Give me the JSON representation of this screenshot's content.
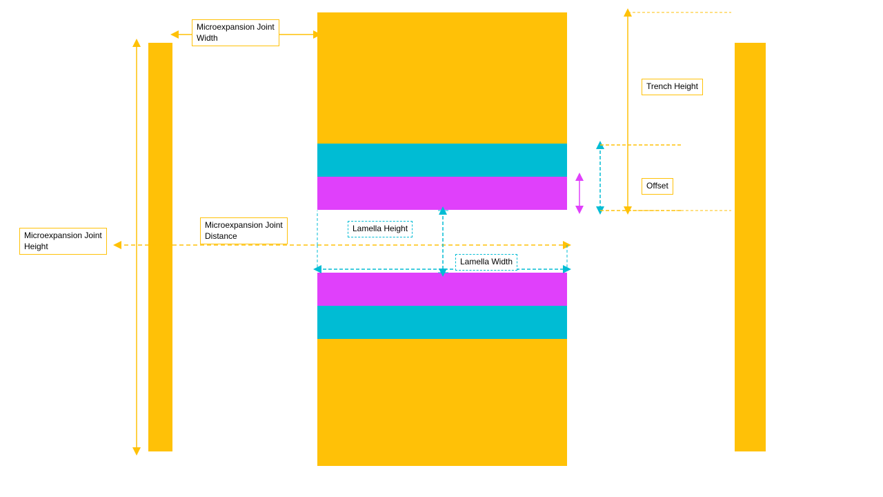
{
  "labels": {
    "microexpansion_joint_width": "Microexpansion Joint\nWidth",
    "microexpansion_joint_distance": "Microexpansion Joint\nDistance",
    "microexpansion_joint_height": "Microexpansion Joint\nHeight",
    "lamella_height": "Lamella Height",
    "lamella_width": "Lamella Width",
    "trench_height": "Trench Height",
    "offset": "Offset"
  },
  "colors": {
    "gold": "#ffc107",
    "cyan": "#00bcd4",
    "magenta": "#e040fb",
    "arrow_gold": "#ffc107",
    "arrow_cyan": "#00bcd4",
    "arrow_magenta": "#e040fb",
    "border_gold": "#ffc107",
    "border_cyan": "#00bcd4"
  }
}
